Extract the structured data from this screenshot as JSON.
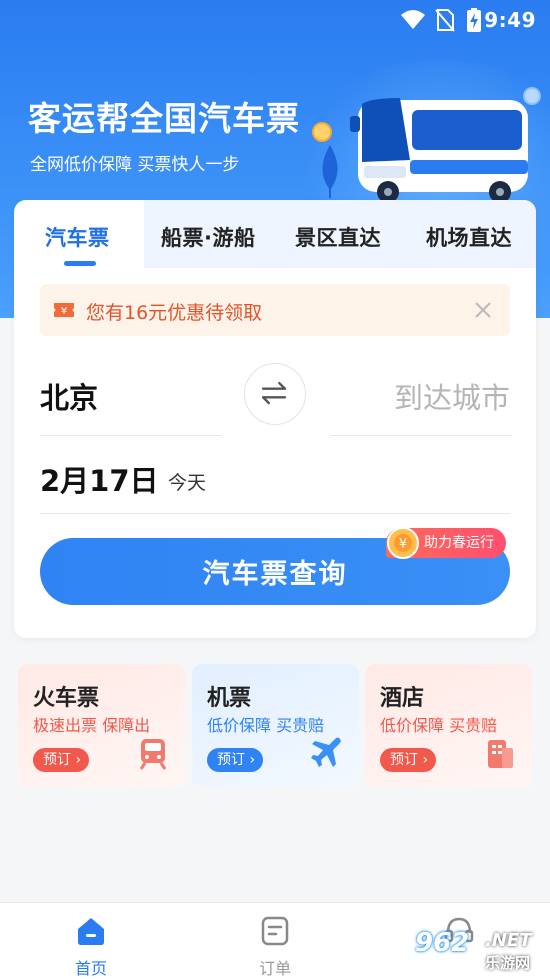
{
  "status_bar": {
    "time": "9:49"
  },
  "hero": {
    "title": "客运帮全国汽车票",
    "subtitle": "全网低价保障 买票快人一步"
  },
  "tabs": [
    {
      "label": "汽车票",
      "active": true
    },
    {
      "label": "船票·游船",
      "active": false
    },
    {
      "label": "景区直达",
      "active": false
    },
    {
      "label": "机场直达",
      "active": false
    }
  ],
  "coupon": {
    "text": "您有16元优惠待领取",
    "icon": "coupon-ticket-icon"
  },
  "search": {
    "from_city": "北京",
    "to_city_placeholder": "到达城市",
    "date": "2月17日",
    "date_note": "今天",
    "button_label": "汽车票查询",
    "promo_badge": "助力春运行"
  },
  "services": [
    {
      "title": "火车票",
      "desc": "极速出票 保障出",
      "button": "预订",
      "icon": "train-icon",
      "accent": "#f2584b"
    },
    {
      "title": "机票",
      "desc": "低价保障 买贵赔",
      "button": "预订",
      "icon": "plane-icon",
      "accent": "#2f83f3"
    },
    {
      "title": "酒店",
      "desc": "低价保障 买贵赔",
      "button": "预订",
      "icon": "hotel-icon",
      "accent": "#f2584b"
    }
  ],
  "bottom_nav": [
    {
      "label": "首页",
      "icon": "home-icon",
      "active": true
    },
    {
      "label": "订单",
      "icon": "order-icon",
      "active": false
    },
    {
      "label": "",
      "icon": "service-icon",
      "active": false
    }
  ],
  "watermark": {
    "number": "962",
    "suffix": ".NET",
    "name": "乐游网"
  },
  "colors": {
    "primary": "#2a7cf0",
    "coupon_text": "#e4532c",
    "coupon_bg": "#fdf3e8"
  }
}
